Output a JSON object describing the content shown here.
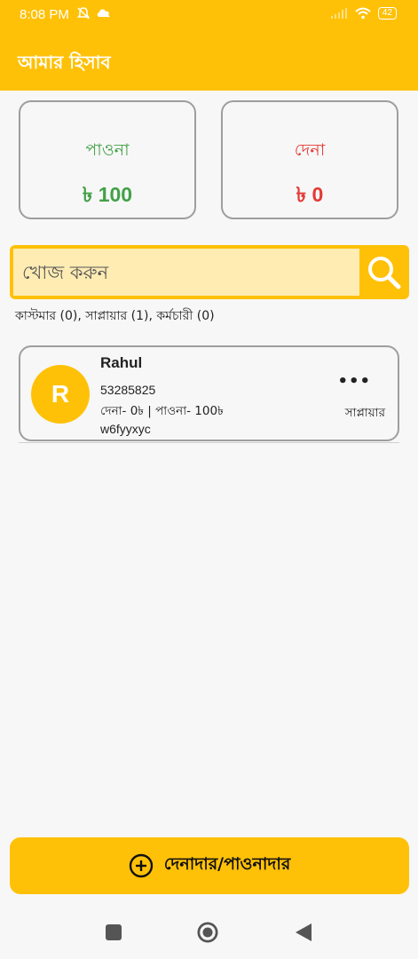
{
  "status_bar": {
    "time": "8:08 PM",
    "battery": "42",
    "icons": [
      "mute-bell-icon",
      "cloud-icon",
      "signal-icon",
      "wifi-icon",
      "battery-icon"
    ]
  },
  "app_bar": {
    "title": "আমার হিসাব"
  },
  "summary": {
    "receivable": {
      "label": "পাওনা",
      "amount": "৳ 100",
      "color": "#43a047"
    },
    "payable": {
      "label": "দেনা",
      "amount": "৳ 0",
      "color": "#e53935"
    }
  },
  "search": {
    "placeholder": "খোজ করুন",
    "icon": "search-icon"
  },
  "counts_text": "কাস্টমার (0), সাপ্লায়ার (1), কর্মচারী (0)",
  "contacts": [
    {
      "initial": "R",
      "name": "Rahul",
      "phone": "53285825",
      "balance": "দেনা- 0৳ | পাওনা- 100৳",
      "code": "w6fyyxyc",
      "more": "•••",
      "type": "সাপ্লায়ার"
    }
  ],
  "add_button": {
    "label": "দেনাদার/পাওনাদার",
    "icon": "plus-circle-icon"
  },
  "nav": [
    "recents-icon",
    "home-icon",
    "back-icon"
  ],
  "colors": {
    "accent": "#ffc107",
    "accent_light": "#ffecb3"
  }
}
